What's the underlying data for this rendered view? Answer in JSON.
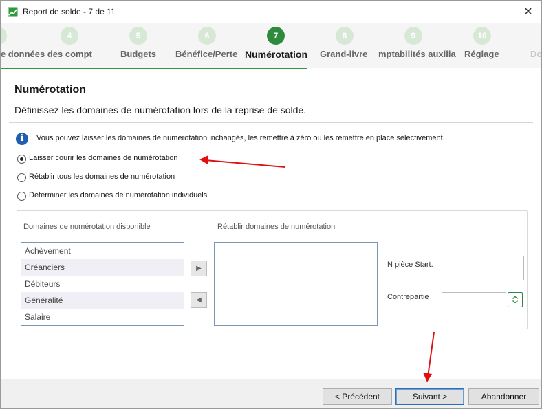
{
  "window": {
    "title": "Report de solde - 7 de 11"
  },
  "steps": [
    {
      "number": "4",
      "label": "de données des compt"
    },
    {
      "number": "5",
      "label": "Budgets"
    },
    {
      "number": "6",
      "label": "Bénéfice/Perte"
    },
    {
      "number": "7",
      "label": "Numérotation",
      "active": true
    },
    {
      "number": "8",
      "label": "Grand-livre"
    },
    {
      "number": "9",
      "label": "mptabilités auxilia"
    },
    {
      "number": "10",
      "label": "Réglage"
    },
    {
      "number": "",
      "label": "Do"
    }
  ],
  "page": {
    "title": "Numérotation",
    "subtitle": "Définissez les domaines de numérotation lors de la reprise de solde.",
    "info": "Vous pouvez laisser les domaines de numérotation inchangés, les remettre à zéro ou les remettre en place sélectivement."
  },
  "options": [
    {
      "label": "Laisser courir les domaines de numérotation",
      "checked": true
    },
    {
      "label": "Rétablir tous les domaines de numérotation",
      "checked": false
    },
    {
      "label": "Déterminer les domaines de numérotation individuels",
      "checked": false
    }
  ],
  "group": {
    "available_label": "Domaines de numérotation disponible",
    "reset_label": "Rétablir domaines de numérotation",
    "available_items": [
      "Achèvement",
      "Créanciers",
      "Débiteurs",
      "Généralité",
      "Salaire"
    ],
    "start_label": "N  pièce Start.",
    "contra_label": "Contrepartie",
    "move_right": "▶",
    "move_left": "◀"
  },
  "footer": {
    "prev": "< Précédent",
    "next": "Suivant >",
    "cancel": "Abandonner"
  },
  "colors": {
    "accent": "#2e9a3b",
    "annotation": "#e01010"
  }
}
